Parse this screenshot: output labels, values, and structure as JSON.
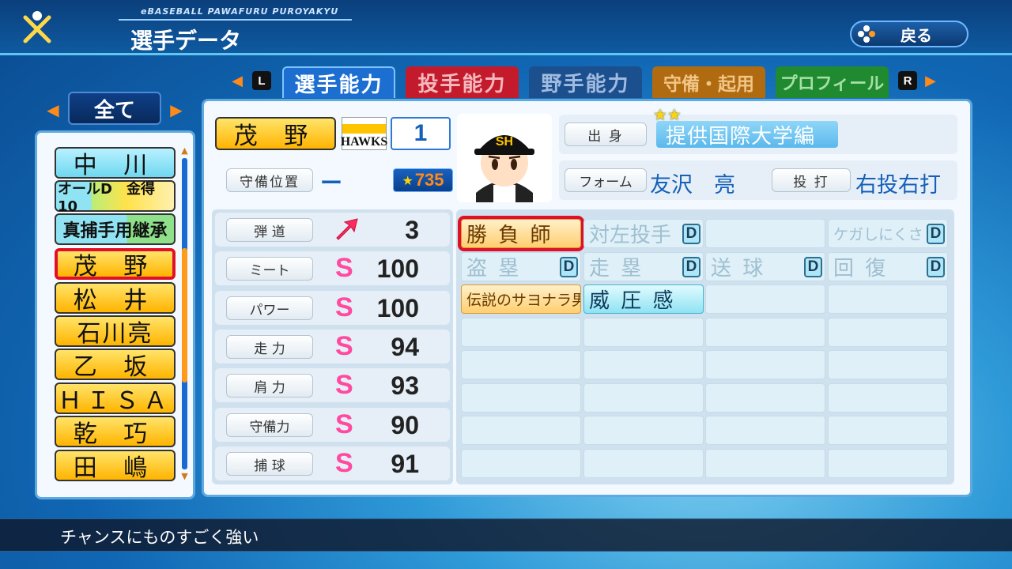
{
  "header": {
    "subtitle": "eBASEBALL PAWAFURU PUROYAKYU",
    "title": "選手データ",
    "back_label": "戻る"
  },
  "tabs": {
    "left_key": "L",
    "right_key": "R",
    "items": [
      {
        "label": "選手能力",
        "color": "#1c6ed1"
      },
      {
        "label": "投手能力",
        "color": "#c31b2c"
      },
      {
        "label": "野手能力",
        "color": "#1c4f8e"
      },
      {
        "label": "守備・起用",
        "color": "#b06b10"
      },
      {
        "label": "プロフィール",
        "color": "#1f8a30"
      }
    ]
  },
  "filter": {
    "label": "全て"
  },
  "roster": [
    {
      "name": "中 川",
      "style": "blue"
    },
    {
      "name": "オールD　金得10",
      "style": "blue-green"
    },
    {
      "name": "真捕手用継承",
      "style": "blue-green"
    },
    {
      "name": "茂 野",
      "style": "yellow",
      "selected": true
    },
    {
      "name": "松 井",
      "style": "yellow"
    },
    {
      "name": "石川亮",
      "style": "yellow"
    },
    {
      "name": "乙 坂",
      "style": "yellow"
    },
    {
      "name": "ＨＩＳＡ",
      "style": "yellow"
    },
    {
      "name": "乾 巧",
      "style": "yellow"
    },
    {
      "name": "田 嶋",
      "style": "yellow"
    }
  ],
  "player": {
    "name": "茂 野",
    "team_logo": "HAWKS",
    "number": "1",
    "position_label": "守備位置",
    "position_value": "ー",
    "rating": "735",
    "origin_label": "出 身",
    "origin_value": "提供国際大学編",
    "origin_stars": "★★",
    "form_label": "フォーム",
    "form_value": "友沢　亮",
    "bat_label": "投 打",
    "bat_value": "右投右打"
  },
  "stats": [
    {
      "label": "弾 道",
      "grade": "",
      "value": "3",
      "trajectory_arrow": "up-right"
    },
    {
      "label": "ミート",
      "grade": "S",
      "value": "100"
    },
    {
      "label": "パワー",
      "grade": "S",
      "value": "100"
    },
    {
      "label": "走 力",
      "grade": "S",
      "value": "94"
    },
    {
      "label": "肩 力",
      "grade": "S",
      "value": "93"
    },
    {
      "label": "守備力",
      "grade": "S",
      "value": "90"
    },
    {
      "label": "捕 球",
      "grade": "S",
      "value": "91"
    }
  ],
  "skills": [
    {
      "text": "勝 負 師",
      "style": "gold",
      "badge": "",
      "selected": true
    },
    {
      "text": "対左投手",
      "style": "faded",
      "badge": "D"
    },
    {
      "text": "",
      "style": "empty",
      "badge": ""
    },
    {
      "text": "ケガしにくさ",
      "style": "faded",
      "badge": "D"
    },
    {
      "text": "盗 塁",
      "style": "faded",
      "badge": "D"
    },
    {
      "text": "走 塁",
      "style": "faded",
      "badge": "D"
    },
    {
      "text": "送 球",
      "style": "faded",
      "badge": "D"
    },
    {
      "text": "回 復",
      "style": "faded",
      "badge": "D"
    },
    {
      "text": "伝説のサヨナラ男",
      "style": "gold",
      "badge": ""
    },
    {
      "text": "威 圧 感",
      "style": "blue",
      "badge": ""
    }
  ],
  "description": "チャンスにものすごく強い"
}
